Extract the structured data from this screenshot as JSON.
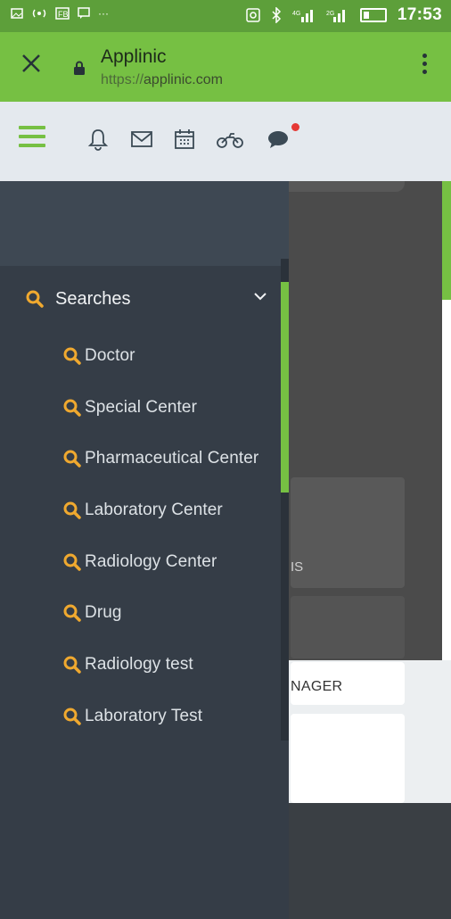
{
  "status_bar": {
    "time": "17:53",
    "left_icons": [
      "image-icon",
      "wifi-hotspot-icon",
      "fb-icon",
      "message-icon",
      "more-icon"
    ],
    "right_icons": [
      "nfc-icon",
      "bluetooth-icon",
      "signal-icon",
      "signal-icon",
      "battery-icon"
    ]
  },
  "browser": {
    "title": "Applinic",
    "url_protocol": "https://",
    "url_host": "applinic.com"
  },
  "toolbar": {
    "icons": [
      "menu-icon",
      "bell-icon",
      "mail-icon",
      "calendar-icon",
      "motorcycle-icon",
      "chat-icon"
    ],
    "notification_dot_color": "#e53935"
  },
  "drawer": {
    "section": {
      "label": "Searches",
      "expanded": true
    },
    "items": [
      {
        "label": "Doctor"
      },
      {
        "label": "Special Center"
      },
      {
        "label": "Pharmaceutical Center"
      },
      {
        "label": "Laboratory Center"
      },
      {
        "label": "Radiology Center"
      },
      {
        "label": "Drug"
      },
      {
        "label": "Radiology test"
      },
      {
        "label": "Laboratory Test"
      }
    ]
  },
  "background": {
    "text1": "IS",
    "text2": "NAGER"
  },
  "colors": {
    "accent_green": "#76c043",
    "icon_orange": "#f0a92f",
    "drawer_bg": "#353d47"
  }
}
